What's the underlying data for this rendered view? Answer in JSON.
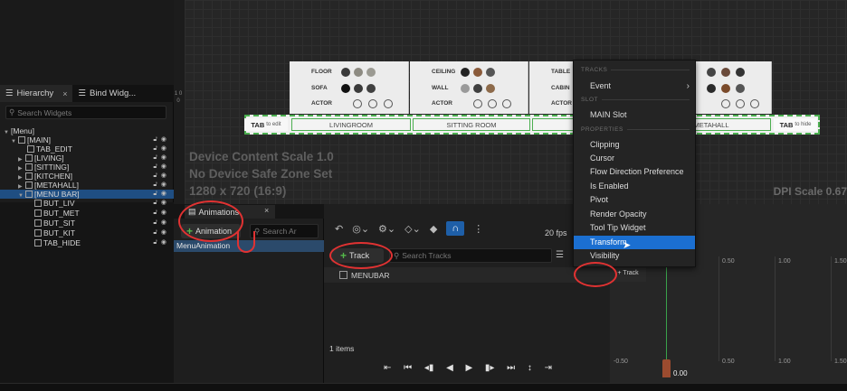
{
  "hierarchy": {
    "tabs": [
      {
        "label": "Hierarchy",
        "close": "×"
      },
      {
        "label": "Bind Widg..."
      }
    ],
    "search_placeholder": "Search Widgets",
    "tree": [
      {
        "label": "[Menu]"
      },
      {
        "label": "[MAIN]"
      },
      {
        "label": "TAB_EDIT"
      },
      {
        "label": "[LIVING]"
      },
      {
        "label": "[SITTING]"
      },
      {
        "label": "[KITCHEN]"
      },
      {
        "label": "[METAHALL]"
      },
      {
        "label": "[MENU BAR]"
      },
      {
        "label": "BUT_LIV"
      },
      {
        "label": "BUT_MET"
      },
      {
        "label": "BUT_SIT"
      },
      {
        "label": "BUT_KIT"
      },
      {
        "label": "TAB_HIDE"
      }
    ]
  },
  "viewport": {
    "device_content_scale": "Device Content Scale 1.0",
    "safe_zone": "No Device Safe Zone Set",
    "resolution": "1280 x 720 (16:9)",
    "dpi_scale": "DPI Scale 0.67",
    "ruler": "1 0 0",
    "cards": [
      {
        "rows": [
          "FLOOR",
          "SOFA",
          "ACTOR"
        ]
      },
      {
        "rows": [
          "CEILING",
          "WALL",
          "ACTOR"
        ]
      },
      {
        "rows": [
          "TABLE",
          "CABIN",
          "ACTOR"
        ]
      }
    ],
    "menubar": {
      "tab_edit": "TAB",
      "tab_edit_small": "to edit",
      "items": [
        "LIVINGROOM",
        "SITTING ROOM",
        "METAHALL"
      ],
      "tab_hide": "TAB",
      "tab_hide_small": "to hide"
    }
  },
  "animations": {
    "tab_label": "Animations",
    "tab_close": "×",
    "add_button": "Animation",
    "search_placeholder": "Search Ar",
    "list": [
      "MenuAnimation"
    ]
  },
  "sequencer": {
    "fps": "20 fps",
    "add_track": "Track",
    "search_placeholder": "Search Tracks",
    "track": "MENUBAR",
    "items_count": "1 items"
  },
  "timeline": {
    "track_button": "Track",
    "ticks_top": [
      "0.50",
      "1.00",
      "1.50"
    ],
    "ticks_bottom": [
      "-0.50",
      "0.50",
      "1.00",
      "1.50"
    ],
    "time": "0.00"
  },
  "context_menu": {
    "sections": {
      "tracks": "TRACKS",
      "slot": "SLOT",
      "properties": "PROPERTIES"
    },
    "event": "Event",
    "slot_item": "MAIN Slot",
    "properties": [
      "Clipping",
      "Cursor",
      "Flow Direction Preference",
      "Is Enabled",
      "Pivot",
      "Render Opacity",
      "Tool Tip Widget",
      "Transform",
      "Visibility"
    ],
    "highlighted": "Transform"
  },
  "colors": {
    "selection": "#1f4e82",
    "highlight": "#1b6fd1",
    "annotation": "#e03232",
    "add_green": "#54b94a",
    "menubar_outline": "#4caf50"
  }
}
